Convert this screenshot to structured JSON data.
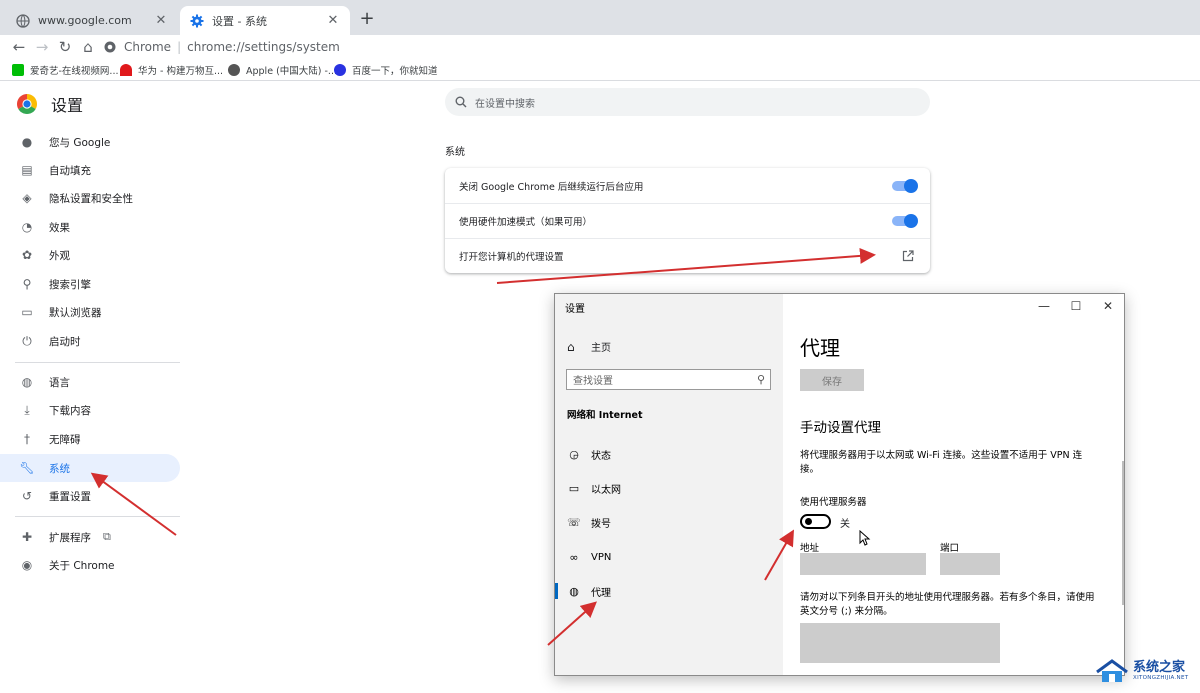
{
  "browser": {
    "tabs": [
      {
        "title": "www.google.com",
        "close": "✕"
      },
      {
        "title": "设置 - 系统",
        "close": "✕"
      }
    ],
    "new_tab": "+",
    "omnibox": {
      "site": "Chrome",
      "sep": "|",
      "url": "chrome://settings/system"
    },
    "bookmarks": [
      {
        "label": "爱奇艺-在线视频网...",
        "color": "#00be06"
      },
      {
        "label": "华为 - 构建万物互...",
        "color": "#e0181b"
      },
      {
        "label": "Apple (中国大陆) -...",
        "color": "#555555"
      },
      {
        "label": "百度一下，你就知道",
        "color": "#2932e1"
      }
    ]
  },
  "settings": {
    "title": "设置",
    "nav": [
      {
        "label": "您与 Google",
        "icon": "person-icon"
      },
      {
        "label": "自动填充",
        "icon": "clipboard-icon"
      },
      {
        "label": "隐私设置和安全性",
        "icon": "shield-icon"
      },
      {
        "label": "效果",
        "icon": "gauge-icon"
      },
      {
        "label": "外观",
        "icon": "palette-icon"
      },
      {
        "label": "搜索引擎",
        "icon": "search-icon"
      },
      {
        "label": "默认浏览器",
        "icon": "browser-icon"
      },
      {
        "label": "启动时",
        "icon": "power-icon"
      },
      {
        "label": "语言",
        "icon": "globe-icon"
      },
      {
        "label": "下载内容",
        "icon": "download-icon"
      },
      {
        "label": "无障碍",
        "icon": "accessibility-icon"
      },
      {
        "label": "系统",
        "icon": "wrench-icon"
      },
      {
        "label": "重置设置",
        "icon": "reset-icon"
      },
      {
        "label": "扩展程序",
        "icon": "puzzle-icon"
      },
      {
        "label": "关于 Chrome",
        "icon": "chrome-icon"
      }
    ],
    "active_item": "系统",
    "search_placeholder": "在设置中搜索",
    "section_title": "系统",
    "rows": [
      {
        "label": "关闭 Google Chrome 后继续运行后台应用",
        "toggle": true
      },
      {
        "label": "使用硬件加速模式（如果可用）",
        "toggle": true
      },
      {
        "label": "打开您计算机的代理设置",
        "toggle": null
      }
    ],
    "accent": "#1a73e8"
  },
  "windows_dialog": {
    "title": "设置",
    "controls": {
      "minimize": "—",
      "maximize": "☐",
      "close": "✕"
    },
    "home": "主页",
    "search_placeholder": "查找设置",
    "group": "网络和 Internet",
    "nav": [
      {
        "label": "状态",
        "icon": "status-icon"
      },
      {
        "label": "以太网",
        "icon": "ethernet-icon"
      },
      {
        "label": "拨号",
        "icon": "dialup-icon"
      },
      {
        "label": "VPN",
        "icon": "vpn-icon"
      },
      {
        "label": "代理",
        "icon": "globe-icon"
      }
    ],
    "active_nav": "代理",
    "page_title": "代理",
    "save": "保存",
    "manual_title": "手动设置代理",
    "manual_desc": "将代理服务器用于以太网或 Wi-Fi 连接。这些设置不适用于 VPN 连接。",
    "use_proxy_label": "使用代理服务器",
    "switch_state": "关",
    "address_label": "地址",
    "port_label": "端口",
    "exceptions_desc": "请勿对以下列条目开头的地址使用代理服务器。若有多个条目，请使用英文分号 (;) 来分隔。"
  },
  "watermark": {
    "main": "系统之家",
    "sub": "XITONGZHIJIA.NET"
  },
  "annotation_color": "#d32f2f"
}
